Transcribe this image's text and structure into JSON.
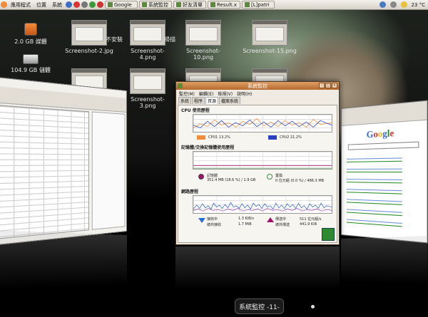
{
  "panel": {
    "menus": [
      "應用程式",
      "位置",
      "系統"
    ],
    "tasks": [
      "Google",
      "系統監控",
      "好友清單",
      "Result.x",
      "[L]patri"
    ],
    "temperature": "23 °C"
  },
  "desktop_icons": [
    {
      "label": "2.0 GB 媒體"
    },
    {
      "label": "104.9 GB 儲體"
    },
    {
      "label": "Screenshot-2.jpg"
    },
    {
      "label": "不安裝"
    },
    {
      "label": "Screenshot-4.png"
    },
    {
      "label": "掃描"
    },
    {
      "label": "Screenshot-10.png"
    },
    {
      "label": "Screenshot-15.png"
    },
    {
      "label": "Screenshot-3.png"
    }
  ],
  "window": {
    "title": "系統監控",
    "menus": [
      "監控(M)",
      "編輯(E)",
      "檢視(V)",
      "說明(H)"
    ],
    "tabs": [
      "系統",
      "程序",
      "資源",
      "檔案系統"
    ],
    "cpu": {
      "title": "CPU 使用歷程",
      "cpu1_label": "CPU1 13.2%",
      "cpu2_label": "CPU2 21.2%",
      "cpu1_color": "#f28c38",
      "cpu2_color": "#2b3fc4"
    },
    "memory": {
      "title": "記憶體/交換記憶體使用歷程",
      "mem_label": "記憶體",
      "mem_value": "351.4 MB (18.6 %) / 1.9 GB",
      "swap_label": "置換",
      "swap_value": "0 位元組 (0.0 %) / 486.3 MB"
    },
    "network": {
      "title": "網路歷程",
      "recv_label": "接收中",
      "recv_rate": "1.3 KiB/s",
      "recv_total_label": "總共接收",
      "recv_total": "1.7 MiB",
      "send_label": "傳送中",
      "send_rate": "511 位元組/s",
      "send_total_label": "總共傳送",
      "send_total": "441.9 KiB"
    }
  },
  "switcher": {
    "label": "系統監控 -11-"
  }
}
